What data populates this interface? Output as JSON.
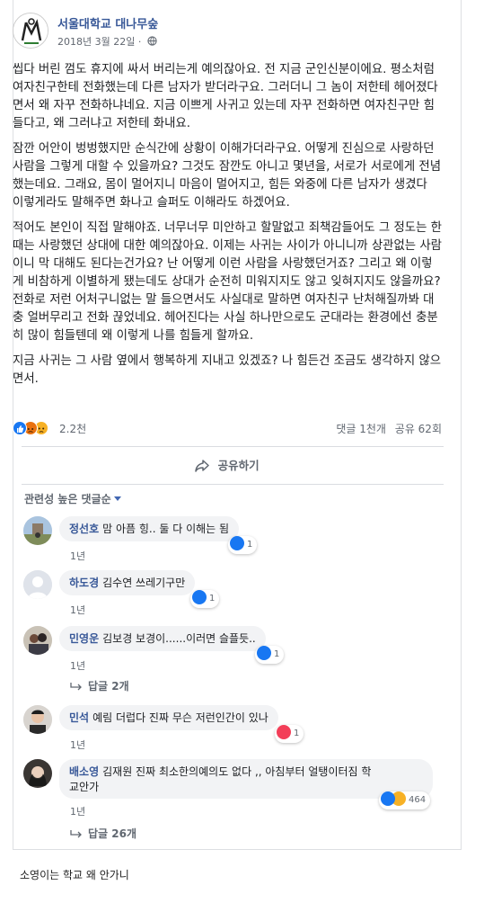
{
  "page": {
    "name": "서울대학교 대나무숲",
    "date": "2018년 3월 22일 ·"
  },
  "post": {
    "paragraphs": [
      "씹다 버린 껌도 휴지에 싸서 버리는게 예의잖아요. 전 지금 군인신분이에요. 평소처럼 여자친구한테 전화했는데 다른 남자가 받더라구요. 그러더니 그 놈이 저한테 헤어졌다면서 왜 자꾸 전화하냐네요. 지금 이쁘게 사귀고 있는데 자꾸 전화하면 여자친구만 힘들다고, 왜 그러냐고 저한테 화내요.",
      "잠깐 어안이 벙벙했지만 순식간에 상황이 이해가더라구요. 어떻게 진심으로 사랑하던 사람을 그렇게 대할 수 있을까요? 그것도 잠깐도 아니고 몇년을, 서로가 서로에게 전념했는데요. 그래요, 몸이 멀어지니 마음이 멀어지고, 힘든 와중에 다른 남자가 생겼다 이렇게라도 말해주면 화나고 슬퍼도 이해라도 하겠어요.",
      "적어도 본인이 직접 말해야죠. 너무너무 미안하고 할말없고 죄책감들어도 그 정도는 한때는 사랑했던 상대에 대한 예의잖아요. 이제는 사귀는 사이가 아니니까 상관없는 사람이니 막 대해도 된다는건가요? 난 어떻게 이런 사람을 사랑했던거죠? 그리고 왜 이렇게 비참하게 이별하게 됐는데도 상대가 순전히 미워지지도 않고 잊혀지지도 않을까요? 전화로 저런 어처구니없는 말 들으면서도 사실대로 말하면 여자친구 난처해질까봐 대충 얼버무리고 전화 끊었네요. 헤어진다는 사실 하나만으로도 군대라는 환경에선 충분히 많이 힘들텐데 왜 이렇게 나를 힘들게 할까요.",
      "지금 사귀는 그 사람 옆에서 행복하게 지내고 있겠죠? 나 힘든건 조금도 생각하지 않으면서."
    ],
    "reaction_count": "2.2천",
    "comment_count": "댓글 1천개",
    "share_count": "공유 62회",
    "share_label": "공유하기",
    "relevance_label": "관련성 높은 댓글순"
  },
  "comments": [
    {
      "author": "정선호",
      "text": "맘 아픔 힝.. 둘 다 이해는 됨",
      "time": "1년",
      "react_count": "1"
    },
    {
      "author": "하도경",
      "text": "김수연 쓰레기구만",
      "time": "1년",
      "react_count": "1"
    },
    {
      "author": "민영운",
      "text": "김보경 보경이......이러면 슬플듯..",
      "time": "1년",
      "react_count": "1",
      "replies": "답글 2개"
    },
    {
      "author": "민석",
      "text": "예림 더럽다 진짜 무슨 저런인간이 있나",
      "time": "1년",
      "react_count": "1"
    },
    {
      "author": "배소영",
      "text_line1": "김재원 진짜 최소한의예의도 없다 ,, 아침부터 얼탱이터짐 학",
      "text_line2": "교안가",
      "time": "1년",
      "react_count": "464",
      "replies": "답글 26개"
    }
  ],
  "caption": "소영이는 학교 왜 안가니",
  "colors": {
    "link_blue": "#385898",
    "like_blue": "#1877f2",
    "love_red": "#f33e58",
    "haha_yellow": "#f7b125"
  },
  "icons": {
    "globe": "globe-icon",
    "share": "share-arrow-icon",
    "reply": "reply-arrow-icon"
  }
}
